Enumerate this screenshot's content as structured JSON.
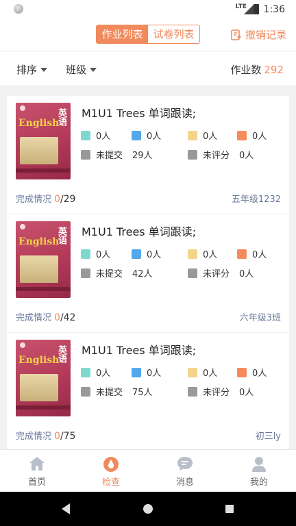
{
  "status_bar": {
    "network": "LTE",
    "time": "1:36"
  },
  "header": {
    "tabs": [
      {
        "label": "作业列表",
        "active": true
      },
      {
        "label": "试卷列表",
        "active": false
      }
    ],
    "revoke_label": "撤销记录"
  },
  "filters": {
    "sort_label": "排序",
    "class_label": "班级",
    "count_label": "作业数",
    "count_value": "292"
  },
  "legend_colors": {
    "teal": "#7fd8cf",
    "blue": "#52a8ec",
    "yellow": "#f3d48a",
    "orange": "#f58a5c",
    "gray": "#999999"
  },
  "cards": [
    {
      "cover": {
        "english": "English",
        "chinese": "英语"
      },
      "title": "M1U1 Trees 单词跟读;",
      "c1": "0人",
      "c2": "0人",
      "c3": "0人",
      "c4": "0人",
      "unsubmitted_label": "未提交",
      "unsubmitted_value": "29人",
      "ungraded_label": "未评分",
      "ungraded_value": "0人",
      "completion_label": "完成情况",
      "done": "0",
      "total": "/29",
      "class_name": "五年级1232"
    },
    {
      "cover": {
        "english": "English",
        "chinese": "英语"
      },
      "title": "M1U1 Trees 单词跟读;",
      "c1": "0人",
      "c2": "0人",
      "c3": "0人",
      "c4": "0人",
      "unsubmitted_label": "未提交",
      "unsubmitted_value": "42人",
      "ungraded_label": "未评分",
      "ungraded_value": "0人",
      "completion_label": "完成情况",
      "done": "0",
      "total": "/42",
      "class_name": "六年级3班"
    },
    {
      "cover": {
        "english": "English",
        "chinese": "英语"
      },
      "title": "M1U1 Trees 单词跟读;",
      "c1": "0人",
      "c2": "0人",
      "c3": "0人",
      "c4": "0人",
      "unsubmitted_label": "未提交",
      "unsubmitted_value": "75人",
      "ungraded_label": "未评分",
      "ungraded_value": "0人",
      "completion_label": "完成情况",
      "done": "0",
      "total": "/75",
      "class_name": "初三ly"
    }
  ],
  "tabbar": [
    {
      "label": "首页",
      "icon": "home-icon",
      "active": false
    },
    {
      "label": "检查",
      "icon": "check-drop-icon",
      "active": true
    },
    {
      "label": "消息",
      "icon": "message-icon",
      "active": false
    },
    {
      "label": "我的",
      "icon": "profile-icon",
      "active": false
    }
  ]
}
